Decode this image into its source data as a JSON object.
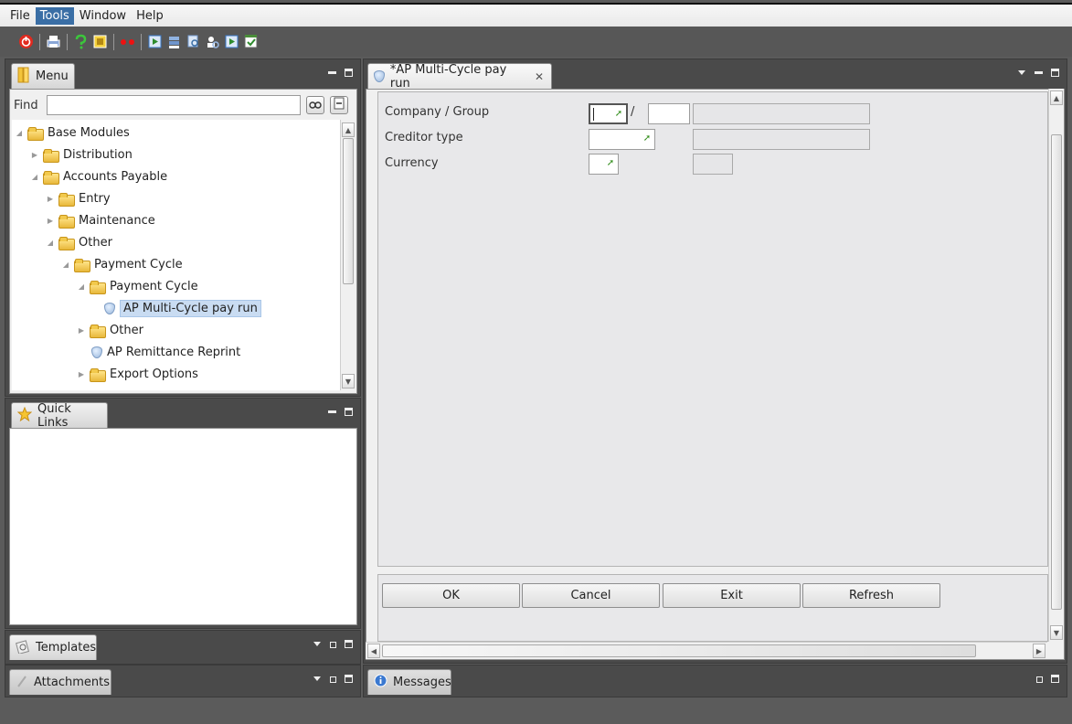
{
  "menubar": {
    "items": [
      "File",
      "Tools",
      "Window",
      "Help"
    ]
  },
  "menu_panel": {
    "tab_label": "Menu",
    "find_label": "Find",
    "find_value": "",
    "tree": [
      {
        "label": "Base Modules",
        "type": "folder",
        "expanded": true
      },
      {
        "label": "Distribution",
        "type": "folder",
        "expanded": false
      },
      {
        "label": "Accounts Payable",
        "type": "folder",
        "expanded": true
      },
      {
        "label": "Entry",
        "type": "folder",
        "expanded": false
      },
      {
        "label": "Maintenance",
        "type": "folder",
        "expanded": false
      },
      {
        "label": "Other",
        "type": "folder",
        "expanded": true
      },
      {
        "label": "Payment Cycle",
        "type": "folder",
        "expanded": true
      },
      {
        "label": "Payment Cycle",
        "type": "folder",
        "expanded": true
      },
      {
        "label": "AP Multi-Cycle pay run",
        "type": "program",
        "selected": true
      },
      {
        "label": "Other",
        "type": "folder",
        "expanded": false
      },
      {
        "label": "AP Remittance Reprint",
        "type": "program"
      },
      {
        "label": "Export Options",
        "type": "folder",
        "expanded": false
      }
    ]
  },
  "quick_links": {
    "tab_label": "Quick Links"
  },
  "templates": {
    "tab_label": "Templates"
  },
  "attachments": {
    "tab_label": "Attachments"
  },
  "messages": {
    "tab_label": "Messages"
  },
  "editor": {
    "tab_label": "*AP Multi-Cycle pay run",
    "fields": {
      "company_group_label": "Company / Group",
      "separator": "/",
      "creditor_type_label": "Creditor type",
      "currency_label": "Currency"
    },
    "buttons": {
      "ok": "OK",
      "cancel": "Cancel",
      "exit": "Exit",
      "refresh": "Refresh"
    }
  },
  "colors": {
    "accent": "#3a6ea5",
    "lookup_green": "#2f8c17",
    "selection": "#c9dcf2"
  }
}
